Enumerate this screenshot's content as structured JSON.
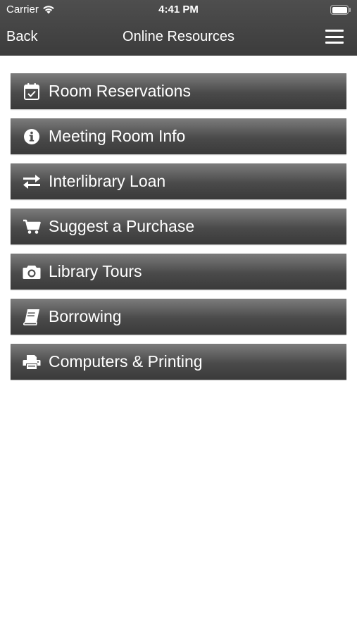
{
  "status_bar": {
    "carrier": "Carrier",
    "time": "4:41 PM"
  },
  "nav": {
    "back_label": "Back",
    "title": "Online Resources"
  },
  "items": [
    {
      "label": "Room Reservations",
      "icon": "calendar-check-icon"
    },
    {
      "label": "Meeting Room Info",
      "icon": "info-icon"
    },
    {
      "label": "Interlibrary Loan",
      "icon": "exchange-icon"
    },
    {
      "label": "Suggest a Purchase",
      "icon": "shopping-cart-icon"
    },
    {
      "label": "Library Tours",
      "icon": "camera-icon"
    },
    {
      "label": "Borrowing",
      "icon": "book-icon"
    },
    {
      "label": "Computers & Printing",
      "icon": "printer-icon"
    }
  ],
  "colors": {
    "header": "#444444",
    "button_top": "#7c7c7c",
    "button_bottom": "#3a3a3a",
    "text": "#ffffff"
  }
}
